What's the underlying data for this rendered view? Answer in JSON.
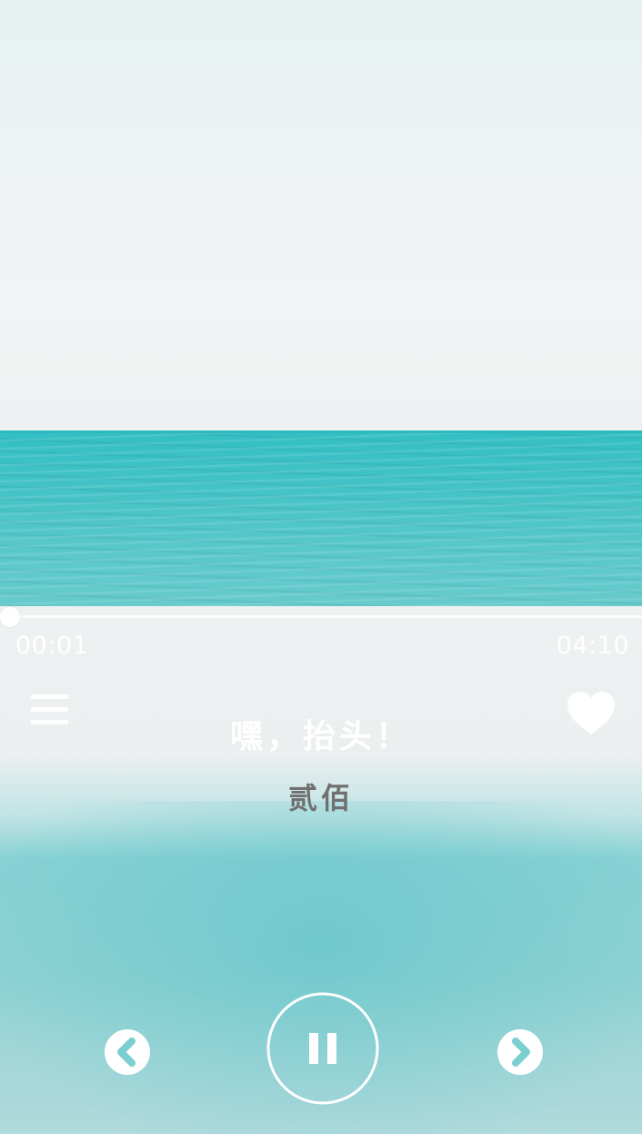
{
  "player": {
    "song_title": "嘿，抬头！",
    "artist": "贰佰",
    "time_elapsed": "00:01",
    "time_total": "04:10",
    "progress_fraction": 0.004
  },
  "icons": {
    "menu": "menu-icon",
    "like": "heart-icon",
    "prev": "chevron-left-circle-icon",
    "play_pause": "pause-icon",
    "next": "chevron-right-circle-icon"
  },
  "colors": {
    "sea": "#33bfc4",
    "sky": "#eef3f4",
    "text_light": "#ffffff",
    "artist_text": "#707070",
    "icon_glyph": "#7ccfd1"
  }
}
